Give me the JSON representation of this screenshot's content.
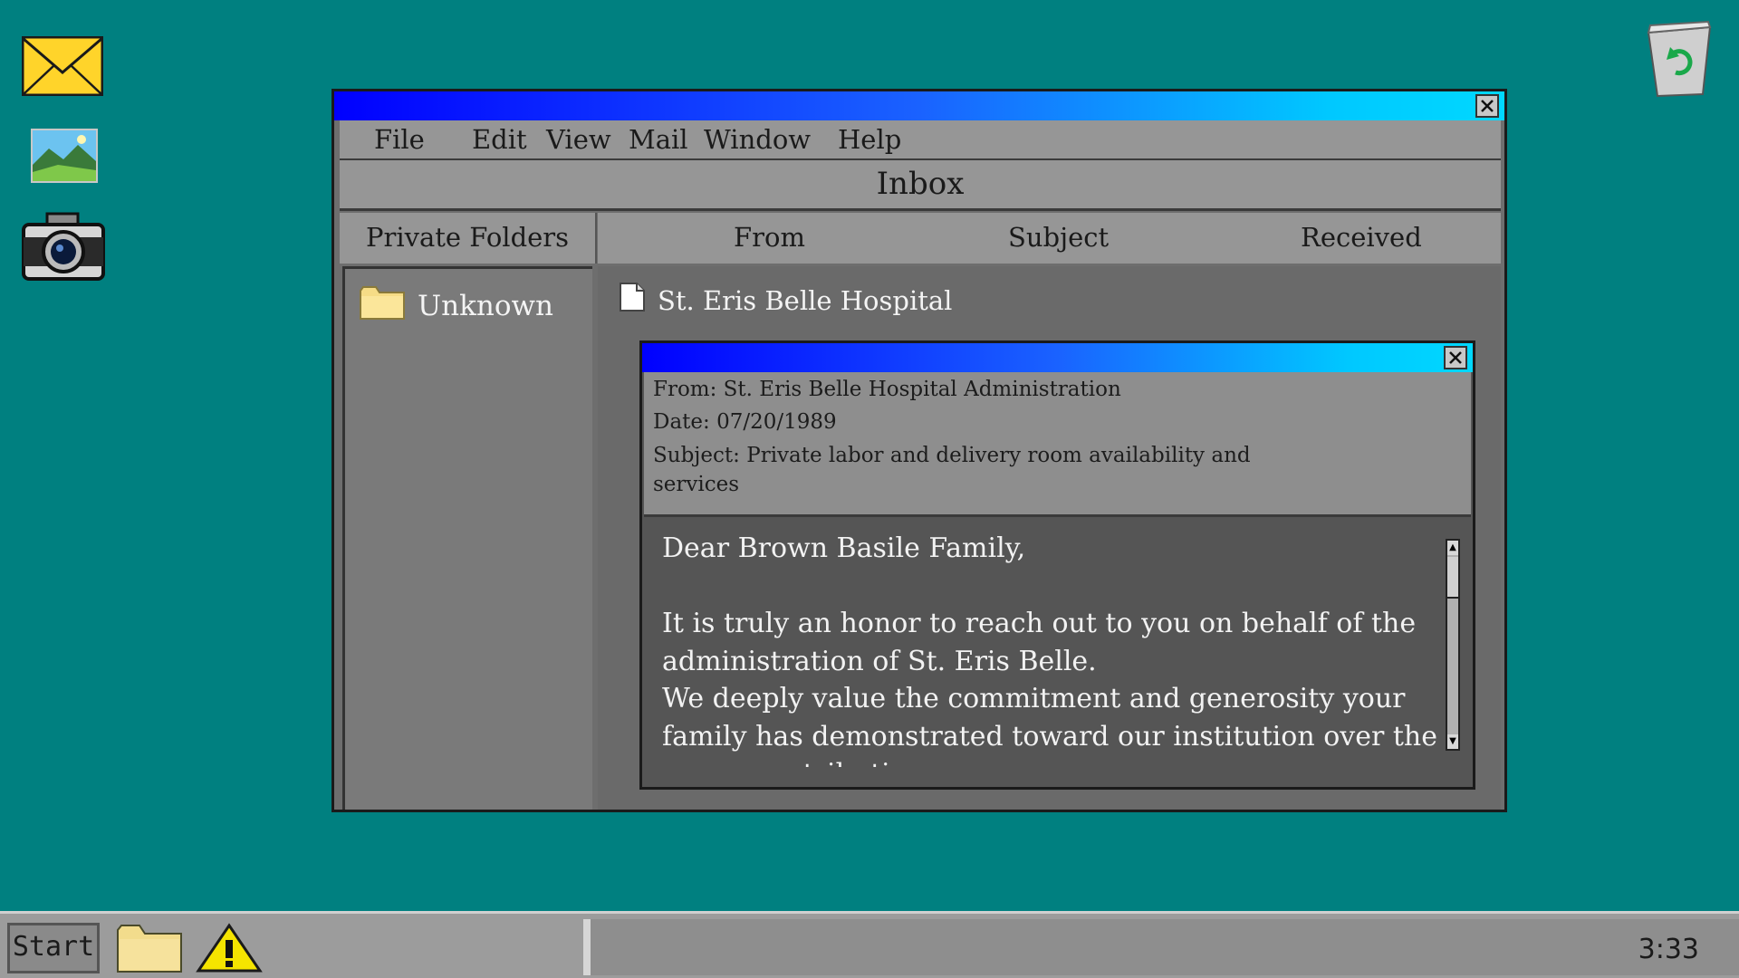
{
  "desktop": {
    "icons": [
      "mail-icon",
      "photo-icon",
      "camera-icon",
      "recycle-bin-icon"
    ]
  },
  "mail_window": {
    "menu": [
      "File",
      "Edit",
      "View",
      "Mail",
      "Window",
      "Help"
    ],
    "title": "Inbox",
    "folders_header": "Private Folders",
    "columns": [
      "From",
      "Subject",
      "Received"
    ],
    "folders": [
      {
        "name": "Unknown",
        "icon": "folder-icon"
      }
    ],
    "messages": [
      {
        "from": "St. Eris Belle Hospital",
        "icon": "document-icon"
      }
    ]
  },
  "message_window": {
    "from": "From: St. Eris Belle Hospital Administration",
    "date": "Date: 07/20/1989",
    "subject": "Subject: Private labor and delivery room availability and services",
    "body": "Dear Brown Basile Family,\n\nIt is truly an honor to reach out to you on behalf of the administration of St. Eris Belle.\nWe deeply value the commitment and generosity your family has demonstrated toward our institution over the years, contributing"
  },
  "taskbar": {
    "start_label": "Start",
    "clock": "3:33"
  },
  "colors": {
    "desktop": "#008080",
    "title_gradient_start": "#0000ff",
    "title_gradient_end": "#00d8ff"
  }
}
